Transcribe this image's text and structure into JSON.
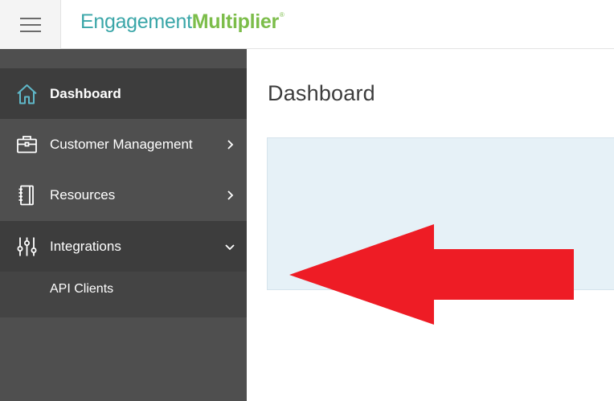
{
  "header": {
    "menu_icon": "hamburger-icon",
    "brand": {
      "part1": "Engagement",
      "part2": "Multiplier",
      "mark": "®"
    }
  },
  "sidebar": {
    "items": [
      {
        "label": "Dashboard",
        "icon": "home-icon",
        "active": true
      },
      {
        "label": "Customer Management",
        "icon": "briefcase-icon",
        "chevron": "chevron-right-icon"
      },
      {
        "label": "Resources",
        "icon": "notebook-icon",
        "chevron": "chevron-right-icon"
      },
      {
        "label": "Integrations",
        "icon": "sliders-icon",
        "chevron": "chevron-down-icon",
        "expanded": true
      }
    ],
    "subitems": [
      {
        "label": "API Clients"
      }
    ]
  },
  "main": {
    "title": "Dashboard"
  },
  "colors": {
    "sidebar_bg": "#4f4f4f",
    "sidebar_active": "#3d3d3d",
    "icon_accent": "#5fb8c9",
    "brand_teal": "#3aa6a8",
    "brand_green": "#7cbd4a",
    "arrow": "#ee1c25",
    "panel_bg": "#e6f1f7"
  }
}
